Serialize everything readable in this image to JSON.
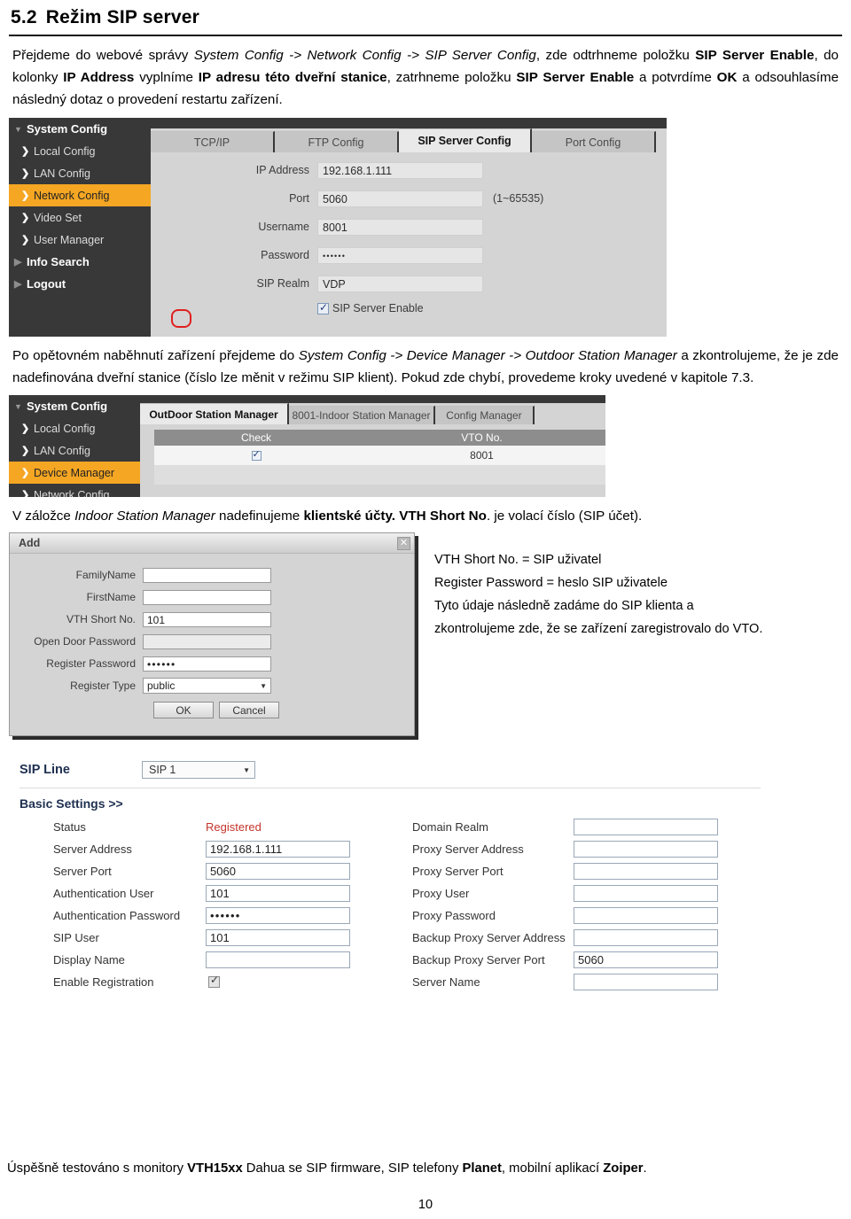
{
  "heading": {
    "number": "5.2",
    "title": "Režim SIP server"
  },
  "paragraphs": {
    "p1_a": "Přejdeme do webové správy ",
    "p1_i1": "System Config -> Network Config -> SIP Server Config",
    "p1_b": ", zde odtrhneme položku ",
    "p1_b1": "SIP Server Enable",
    "p1_c": ", do kolonky ",
    "p1_b2": "IP Address",
    "p1_d": " vyplníme ",
    "p1_b3": "IP adresu této dveřní stanice",
    "p1_e": ", zatrhneme položku ",
    "p1_b4": "SIP Server Enable",
    "p1_f": " a potvrdíme ",
    "p1_b5": "OK",
    "p1_g": " a odsouhlasíme následný dotaz o provedení restartu zařízení.",
    "p2_a": "Po opětovném naběhnutí zařízení přejdeme do ",
    "p2_i1": "System Config -> Device Manager -> Outdoor Station Manager",
    "p2_b": " a zkontrolujeme, že je zde nadefinována dveřní stanice (číslo lze měnit v režimu SIP klient). Pokud zde chybí, provedeme kroky uvedené v kapitole 7.3.",
    "p3_a": "V záložce ",
    "p3_i1": "Indoor Station Manager",
    "p3_b": " nadefinujeme ",
    "p3_b1": "klientské účty. VTH Short No",
    "p3_c": ". je volací číslo (SIP účet)."
  },
  "shot1": {
    "sidebar": [
      {
        "label": "System Config",
        "icon": "caret-down-icon",
        "level": "root",
        "active": false
      },
      {
        "label": "Local Config",
        "icon": "chevron-right-icon",
        "level": "sub",
        "active": false
      },
      {
        "label": "LAN Config",
        "icon": "chevron-right-icon",
        "level": "sub",
        "active": false
      },
      {
        "label": "Network Config",
        "icon": "chevron-right-icon",
        "level": "sub",
        "active": true
      },
      {
        "label": "Video Set",
        "icon": "chevron-right-icon",
        "level": "sub",
        "active": false
      },
      {
        "label": "User Manager",
        "icon": "chevron-right-icon",
        "level": "sub",
        "active": false
      },
      {
        "label": "Info Search",
        "icon": "caret-right-icon",
        "level": "root",
        "active": false
      },
      {
        "label": "Logout",
        "icon": "caret-right-icon",
        "level": "root",
        "active": false
      }
    ],
    "tabs": [
      {
        "label": "TCP/IP",
        "active": false
      },
      {
        "label": "FTP Config",
        "active": false
      },
      {
        "label": "SIP Server Config",
        "active": true
      },
      {
        "label": "Port Config",
        "active": false
      }
    ],
    "fields": [
      {
        "label": "IP Address",
        "value": "192.168.1.111",
        "hint": ""
      },
      {
        "label": "Port",
        "value": "5060",
        "hint": "(1~65535)"
      },
      {
        "label": "Username",
        "value": "8001",
        "hint": ""
      },
      {
        "label": "Password",
        "value": "••••••",
        "hint": ""
      },
      {
        "label": "SIP Realm",
        "value": "VDP",
        "hint": ""
      }
    ],
    "checkbox": {
      "label": "SIP Server Enable",
      "checked": true
    }
  },
  "shot2": {
    "sidebar": [
      {
        "label": "System Config",
        "level": "root",
        "active": false
      },
      {
        "label": "Local Config",
        "level": "sub",
        "active": false
      },
      {
        "label": "LAN Config",
        "level": "sub",
        "active": false
      },
      {
        "label": "Device Manager",
        "level": "sub",
        "active": true
      },
      {
        "label": "Network Config",
        "level": "sub",
        "active": false
      }
    ],
    "tabs": [
      {
        "label": "OutDoor Station Manager",
        "active": true
      },
      {
        "label": "8001-Indoor Station Manager",
        "active": false
      },
      {
        "label": "Config Manager",
        "active": false
      }
    ],
    "table": {
      "headers": [
        "Check",
        "VTO No."
      ],
      "rows": [
        {
          "checked": true,
          "vto_no": "8001"
        }
      ]
    }
  },
  "add_dialog": {
    "title": "Add",
    "close_icon": "close-icon",
    "fields": [
      {
        "label": "FamilyName",
        "value": "",
        "type": "text",
        "disabled": false
      },
      {
        "label": "FirstName",
        "value": "",
        "type": "text",
        "disabled": false
      },
      {
        "label": "VTH Short No.",
        "value": "101",
        "type": "text",
        "disabled": false
      },
      {
        "label": "Open Door Password",
        "value": "",
        "type": "text",
        "disabled": true
      },
      {
        "label": "Register Password",
        "value": "••••••",
        "type": "text",
        "disabled": false
      },
      {
        "label": "Register Type",
        "value": "public",
        "type": "select",
        "disabled": false
      }
    ],
    "buttons": [
      {
        "label": "OK"
      },
      {
        "label": "Cancel"
      }
    ]
  },
  "side_note": [
    "VTH Short No. = SIP uživatel",
    "Register Password = heslo SIP uživatele",
    "Tyto údaje následně zadáme do SIP klienta a",
    "zkontrolujeme zde, že se zařízení zaregistrovalo do VTO."
  ],
  "sip_line": {
    "title": "SIP Line",
    "selected": "SIP 1",
    "basic_settings": "Basic Settings >>",
    "status_color": "#c4342b",
    "left": [
      {
        "label": "Status",
        "value": "Registered",
        "type": "status"
      },
      {
        "label": "Server Address",
        "value": "192.168.1.111",
        "type": "input"
      },
      {
        "label": "Server Port",
        "value": "5060",
        "type": "input"
      },
      {
        "label": "Authentication User",
        "value": "101",
        "type": "input"
      },
      {
        "label": "Authentication Password",
        "value": "••••••",
        "type": "input"
      },
      {
        "label": "SIP User",
        "value": "101",
        "type": "input"
      },
      {
        "label": "Display Name",
        "value": "",
        "type": "input"
      },
      {
        "label": "Enable Registration",
        "value": "",
        "type": "checkbox",
        "checked": true
      }
    ],
    "right": [
      {
        "label": "Domain Realm",
        "value": "",
        "type": "input"
      },
      {
        "label": "Proxy Server Address",
        "value": "",
        "type": "input"
      },
      {
        "label": "Proxy Server Port",
        "value": "",
        "type": "input"
      },
      {
        "label": "Proxy User",
        "value": "",
        "type": "input"
      },
      {
        "label": "Proxy Password",
        "value": "",
        "type": "input"
      },
      {
        "label": "Backup Proxy Server Address",
        "value": "",
        "type": "input"
      },
      {
        "label": "Backup Proxy Server Port",
        "value": "5060",
        "type": "input"
      },
      {
        "label": "Server Name",
        "value": "",
        "type": "input"
      }
    ]
  },
  "footer": {
    "a": "Úspěšně testováno s monitory ",
    "b1": "VTH15xx",
    "c": " Dahua se SIP firmware, SIP telefony ",
    "b2": "Planet",
    "d": ", mobilní aplikací ",
    "b3": "Zoiper",
    "e": ".",
    "page_number": "10"
  }
}
